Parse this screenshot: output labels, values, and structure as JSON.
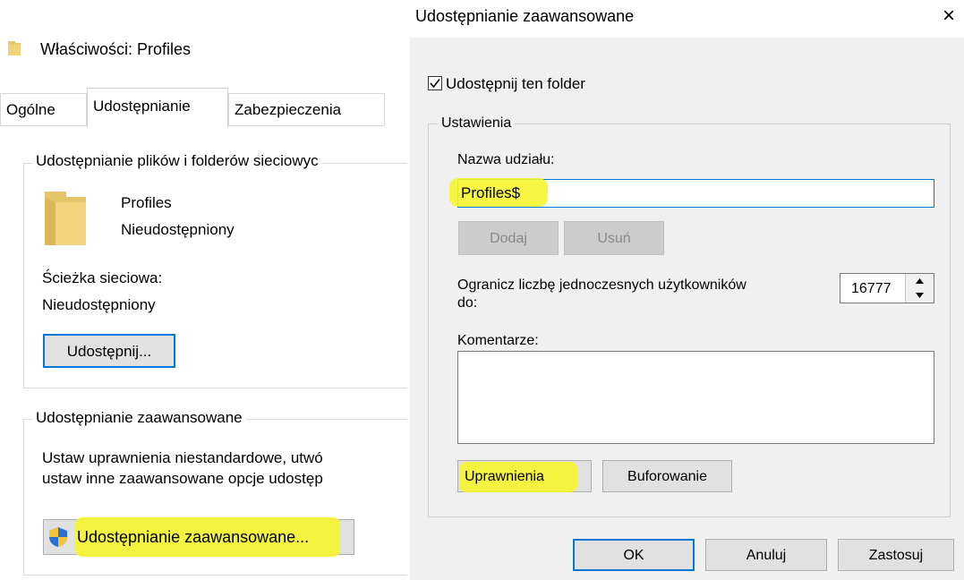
{
  "properties": {
    "title": "Właściwości: Profiles",
    "tabs": [
      "Ogólne",
      "Udostępnianie",
      "Zabezpieczenia"
    ],
    "network_sharing": {
      "legend": "Udostępnianie plików i folderów sieciowyc",
      "folder_name": "Profiles",
      "folder_status": "Nieudostępniony",
      "path_label": "Ścieżka sieciowa:",
      "path_value": "Nieudostępniony",
      "share_button": "Udostępnij..."
    },
    "advanced_sharing": {
      "legend": "Udostępnianie zaawansowane",
      "description_line1": "Ustaw uprawnienia niestandardowe, utwó",
      "description_line2": "ustaw inne zaawansowane opcje udostęp",
      "button": "Udostępnianie zaawansowane..."
    }
  },
  "advanced_dialog": {
    "title": "Udostępnianie zaawansowane",
    "close_glyph": "×",
    "share_checkbox_label": "Udostępnij ten folder",
    "share_checked": true,
    "settings": {
      "legend": "Ustawienia",
      "share_name_label": "Nazwa udziału:",
      "share_name_value": "Profiles$",
      "add_button": "Dodaj",
      "remove_button": "Usuń",
      "limit_label_line1": "Ogranicz liczbę jednoczesnych użytkowników",
      "limit_label_line2": "do:",
      "limit_value": "16777",
      "comments_label": "Komentarze:",
      "comments_value": "",
      "permissions_button": "Uprawnienia",
      "caching_button": "Buforowanie"
    },
    "buttons": {
      "ok": "OK",
      "cancel": "Anuluj",
      "apply": "Zastosuj"
    }
  },
  "colors": {
    "highlight": "#f6f52e",
    "folder": "#e8c66a",
    "focus_border": "#0078d7",
    "dialog_bg": "#f0f0f0"
  }
}
